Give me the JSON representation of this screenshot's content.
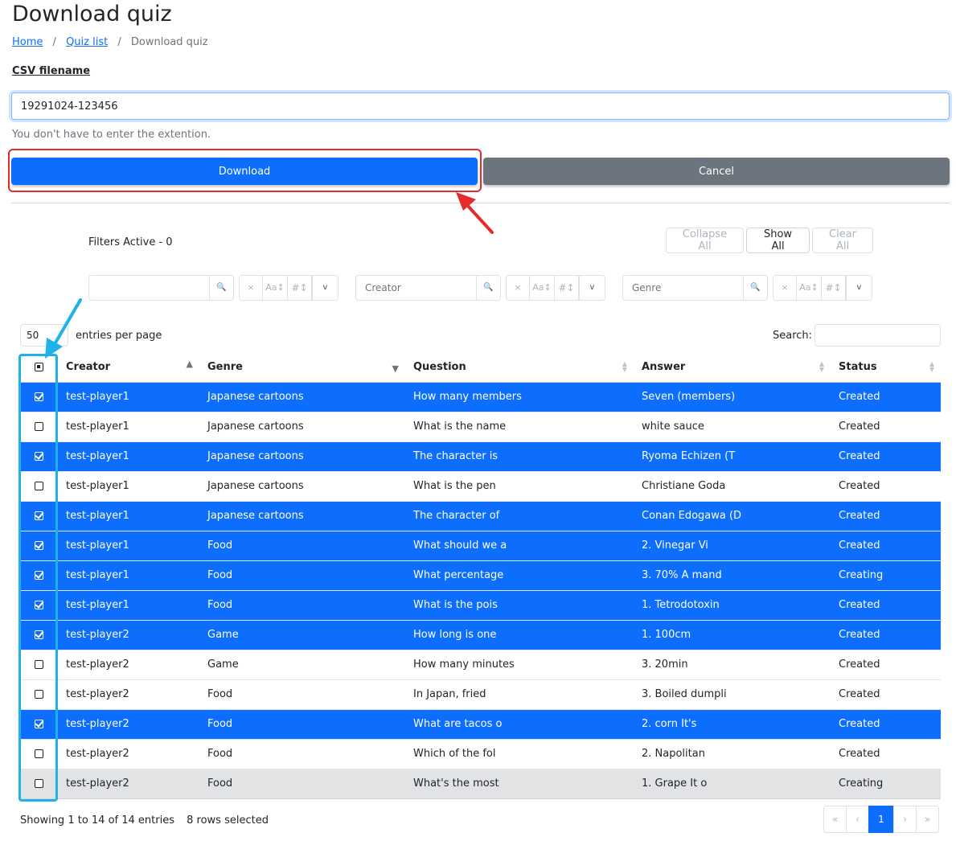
{
  "page": {
    "title": "Download quiz",
    "breadcrumb": [
      {
        "label": "Home",
        "link": true
      },
      {
        "label": "Quiz list",
        "link": true
      },
      {
        "label": "Download quiz",
        "link": false
      }
    ]
  },
  "form": {
    "filename_label": "CSV filename",
    "filename_value": "19291024-123456",
    "hint": "You don't have to enter the extention.",
    "download_label": "Download",
    "cancel_label": "Cancel"
  },
  "filters": {
    "active_text": "Filters Active - 0",
    "collapse_all": "Collapse All",
    "show_all": "Show All",
    "clear_all": "Clear All",
    "inputs": [
      {
        "placeholder": ""
      },
      {
        "placeholder": "Creator"
      },
      {
        "placeholder": "Genre"
      }
    ],
    "icons": {
      "clear": "×",
      "case": "Aa↕",
      "number": "#↕",
      "menu": "v",
      "search": "search-icon"
    }
  },
  "table_controls": {
    "entries_value": "50",
    "entries_label": "entries per page",
    "search_label": "Search:"
  },
  "table": {
    "columns": [
      "Creator",
      "Genre",
      "Question",
      "Answer",
      "Status"
    ],
    "rows": [
      {
        "creator": "test-player1",
        "genre": "Japanese cartoons",
        "question": "How many members",
        "answer": "Seven (members)",
        "status": "Created",
        "selected": true
      },
      {
        "creator": "test-player1",
        "genre": "Japanese cartoons",
        "question": "What is the name",
        "answer": "white sauce",
        "status": "Created",
        "selected": false
      },
      {
        "creator": "test-player1",
        "genre": "Japanese cartoons",
        "question": "The character is",
        "answer": "Ryoma Echizen (T",
        "status": "Created",
        "selected": true
      },
      {
        "creator": "test-player1",
        "genre": "Japanese cartoons",
        "question": "What is the pen",
        "answer": "Christiane Goda",
        "status": "Created",
        "selected": false
      },
      {
        "creator": "test-player1",
        "genre": "Japanese cartoons",
        "question": "The character of",
        "answer": "Conan Edogawa (D",
        "status": "Created",
        "selected": true
      },
      {
        "creator": "test-player1",
        "genre": "Food",
        "question": "What should we a",
        "answer": "2. Vinegar Vi",
        "status": "Created",
        "selected": true
      },
      {
        "creator": "test-player1",
        "genre": "Food",
        "question": "What percentage",
        "answer": "3. 70% A mand",
        "status": "Creating",
        "selected": true
      },
      {
        "creator": "test-player1",
        "genre": "Food",
        "question": "What is the pois",
        "answer": "1. Tetrodotoxin",
        "status": "Created",
        "selected": true
      },
      {
        "creator": "test-player2",
        "genre": "Game",
        "question": "How long is one",
        "answer": "1. 100cm",
        "status": "Created",
        "selected": true
      },
      {
        "creator": "test-player2",
        "genre": "Game",
        "question": "How many minutes",
        "answer": "3. 20min",
        "status": "Created",
        "selected": false
      },
      {
        "creator": "test-player2",
        "genre": "Food",
        "question": "In Japan, fried",
        "answer": "3. Boiled dumpli",
        "status": "Created",
        "selected": false
      },
      {
        "creator": "test-player2",
        "genre": "Food",
        "question": "What are tacos o",
        "answer": "2. corn It's",
        "status": "Created",
        "selected": true
      },
      {
        "creator": "test-player2",
        "genre": "Food",
        "question": "Which of the fol",
        "answer": "2. Napolitan",
        "status": "Created",
        "selected": false
      },
      {
        "creator": "test-player2",
        "genre": "Food",
        "question": "What's the most",
        "answer": "1. Grape It o",
        "status": "Creating",
        "selected": false,
        "hover": true
      }
    ]
  },
  "footer": {
    "info": "Showing 1 to 14 of 14 entries",
    "selected_info": "8 rows selected",
    "pager": [
      "«",
      "‹",
      "1",
      "›",
      "»"
    ],
    "current_page": "1"
  },
  "colors": {
    "primary": "#0d6efd",
    "secondary": "#6c757d",
    "highlight_red": "#e52b2b",
    "highlight_cyan": "#1fb2e8"
  }
}
